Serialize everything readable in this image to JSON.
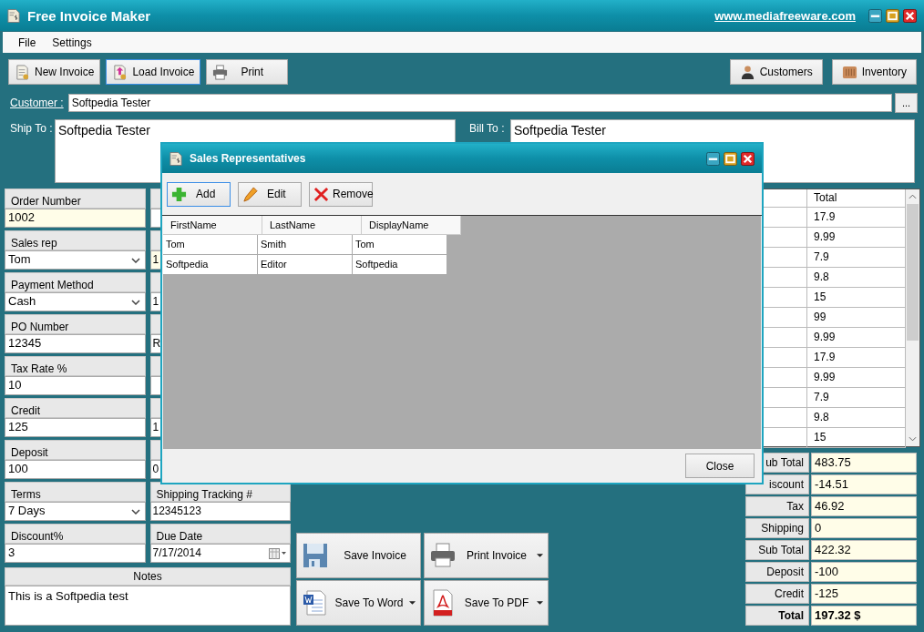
{
  "window": {
    "title": "Free Invoice Maker",
    "link": "www.mediafreeware.com"
  },
  "menu": [
    "File",
    "Settings"
  ],
  "toolbar_left": [
    {
      "label": "New Invoice",
      "kind": "new",
      "selected": false
    },
    {
      "label": "Load Invoice",
      "kind": "load",
      "selected": true
    },
    {
      "label": "Print",
      "kind": "print",
      "selected": false
    }
  ],
  "toolbar_right": [
    {
      "label": "Customers",
      "kind": "customers"
    },
    {
      "label": "Inventory",
      "kind": "inventory"
    }
  ],
  "customer": {
    "label": "Customer :",
    "value": "Softpedia Tester",
    "browse": "..."
  },
  "ship_to": {
    "label": "Ship To :",
    "value": "Softpedia Tester"
  },
  "bill_to": {
    "label": "Bill To :",
    "value": "Softpedia Tester"
  },
  "left_fields": [
    {
      "label": "Order Number",
      "value": "1002",
      "kind": "text",
      "highlighted": true
    },
    {
      "label": "Sales rep",
      "value": "Tom",
      "kind": "dropdown",
      "highlighted": false
    },
    {
      "label": "Payment Method",
      "value": "Cash",
      "kind": "dropdown",
      "highlighted": false
    },
    {
      "label": "PO Number",
      "value": "12345",
      "kind": "text",
      "highlighted": false
    },
    {
      "label": "Tax Rate %",
      "value": "10",
      "kind": "text",
      "highlighted": false
    },
    {
      "label": "Credit",
      "value": "125",
      "kind": "text",
      "highlighted": false
    },
    {
      "label": "Deposit",
      "value": "100",
      "kind": "text",
      "highlighted": false
    },
    {
      "label": "Terms",
      "value": "7 Days",
      "kind": "dropdown",
      "highlighted": false
    },
    {
      "label": "Discount%",
      "value": "3",
      "kind": "text",
      "highlighted": false
    }
  ],
  "middle_fields": [
    {
      "kind": "text",
      "highlighted": false
    },
    {
      "value": "1",
      "kind": "text",
      "highlighted": true
    },
    {
      "value": "1",
      "kind": "text",
      "highlighted": false
    },
    {
      "value": "R",
      "kind": "text",
      "highlighted": false
    },
    {
      "kind": "text",
      "highlighted": false
    },
    {
      "value": "1",
      "kind": "text",
      "highlighted": false
    },
    {
      "value": "0",
      "kind": "text",
      "highlighted": false
    },
    {
      "label": "Shipping Tracking #",
      "value": "12345123",
      "kind": "text",
      "highlighted": false
    },
    {
      "label": "Due Date",
      "value": "7/17/2014",
      "kind": "date",
      "highlighted": false
    }
  ],
  "notes": {
    "label": "Notes",
    "value": "This is a Softpedia test"
  },
  "items": {
    "column_total": "Total",
    "rows": [
      "17.9",
      "9.99",
      "7.9",
      "9.8",
      "15",
      "99",
      "9.99",
      "17.9",
      "9.99",
      "7.9",
      "9.8",
      "15"
    ]
  },
  "actions": [
    {
      "label": "Save Invoice",
      "kind": "save",
      "dropdown": false
    },
    {
      "label": "Print Invoice",
      "kind": "print",
      "dropdown": true
    },
    {
      "label": "Save To Word",
      "kind": "word",
      "dropdown": true
    },
    {
      "label": "Save To PDF",
      "kind": "pdf",
      "dropdown": true
    }
  ],
  "summary": [
    {
      "label": "ub Total",
      "value": "483.75",
      "bold": false
    },
    {
      "label": "iscount",
      "value": "-14.51",
      "bold": false
    },
    {
      "label": "Tax",
      "value": "46.92",
      "bold": false
    },
    {
      "label": "Shipping",
      "value": "0",
      "bold": false
    },
    {
      "label": "Sub Total",
      "value": "422.32",
      "bold": false
    },
    {
      "label": "Deposit",
      "value": "-100",
      "bold": false
    },
    {
      "label": "Credit",
      "value": "-125",
      "bold": false
    },
    {
      "label": "Total",
      "value": "197.32 $",
      "bold": true
    }
  ],
  "dialog": {
    "title": "Sales Representatives",
    "buttons": [
      {
        "label": "Add",
        "kind": "add",
        "selected": true
      },
      {
        "label": "Edit",
        "kind": "edit",
        "selected": false
      },
      {
        "label": "Remove",
        "kind": "remove",
        "selected": false
      }
    ],
    "columns": [
      "FirstName",
      "LastName",
      "DisplayName"
    ],
    "rows": [
      [
        "Tom",
        "Smith",
        "Tom"
      ],
      [
        "Softpedia",
        "Editor",
        "Softpedia"
      ]
    ],
    "close": "Close"
  }
}
